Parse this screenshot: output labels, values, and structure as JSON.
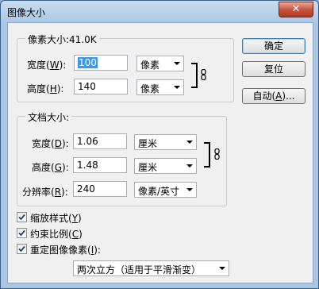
{
  "window": {
    "title": "图像大小",
    "close_symbol": "✕"
  },
  "pixel_dims": {
    "group_title": "像素大小:41.0K",
    "width_label": "宽度",
    "width_key": "W",
    "width_value": "100",
    "width_unit": "像素",
    "height_label": "高度",
    "height_key": "H",
    "height_value": "140",
    "height_unit": "像素"
  },
  "doc_size": {
    "group_title": "文档大小:",
    "width_label": "宽度",
    "width_key": "D",
    "width_value": "1.06",
    "width_unit": "厘米",
    "height_label": "高度",
    "height_key": "G",
    "height_value": "1.48",
    "height_unit": "厘米",
    "res_label": "分辨率",
    "res_key": "R",
    "res_value": "240",
    "res_unit": "像素/英寸"
  },
  "options": {
    "scale_styles": {
      "label": "缩放样式",
      "key": "Y",
      "checked": true
    },
    "constrain": {
      "label": "约束比例",
      "key": "C",
      "checked": true
    },
    "resample": {
      "label": "重定图像像素",
      "key": "I",
      "checked": true
    },
    "resample_method": "两次立方（适用于平滑渐变）"
  },
  "buttons": {
    "ok": "确定",
    "reset": "复位",
    "auto": "自动",
    "auto_key": "A",
    "auto_suffix": "..."
  },
  "colors": {
    "title_bg": "#a9c6e4",
    "close_btn": "#c8553e",
    "selection": "#3399ff"
  }
}
